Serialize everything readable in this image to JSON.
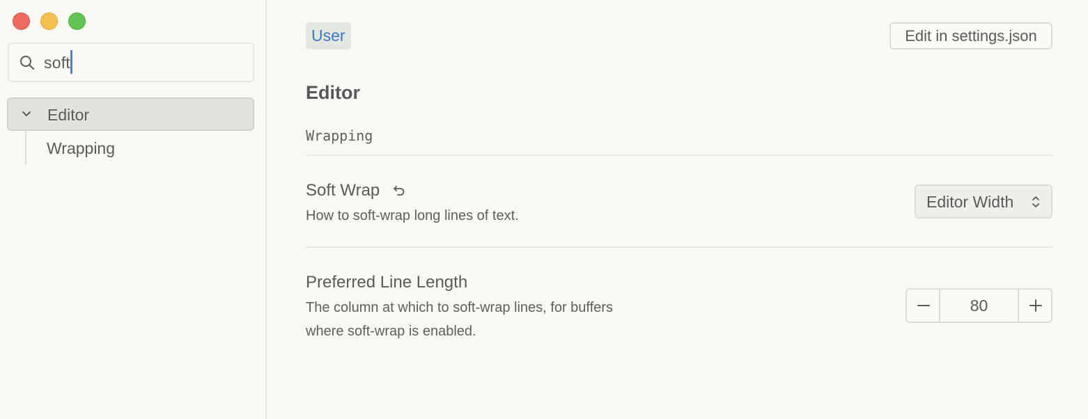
{
  "window": {
    "traffic_lights": {
      "close": "#ee6a5f",
      "minimize": "#f5bf4f",
      "maximize": "#62c554"
    }
  },
  "sidebar": {
    "search": {
      "value": "soft",
      "icon": "search-icon"
    },
    "tree": {
      "group_label": "Editor",
      "group_expanded": true,
      "children": [
        {
          "label": "Wrapping"
        }
      ]
    }
  },
  "main": {
    "scope_badge": "User",
    "edit_button": "Edit in settings.json",
    "section_title": "Editor",
    "subsection_title": "Wrapping",
    "settings": [
      {
        "title": "Soft Wrap",
        "description": "How to soft-wrap long lines of text.",
        "control": {
          "type": "dropdown",
          "value": "Editor Width",
          "icon": "chevron-up-down-icon"
        },
        "reset_icon": "reset-icon"
      },
      {
        "title": "Preferred Line Length",
        "description_line1": "The column at which to soft-wrap lines, for buffers",
        "description_line2": "where soft-wrap is enabled.",
        "control": {
          "type": "stepper",
          "value": "80",
          "decrement": "minus-icon",
          "increment": "plus-icon"
        }
      }
    ]
  },
  "colors": {
    "background": "#f9f8f3",
    "accent": "#3e79c9",
    "caret": "#3f82e0",
    "selected_row": "#e3e2dc"
  }
}
